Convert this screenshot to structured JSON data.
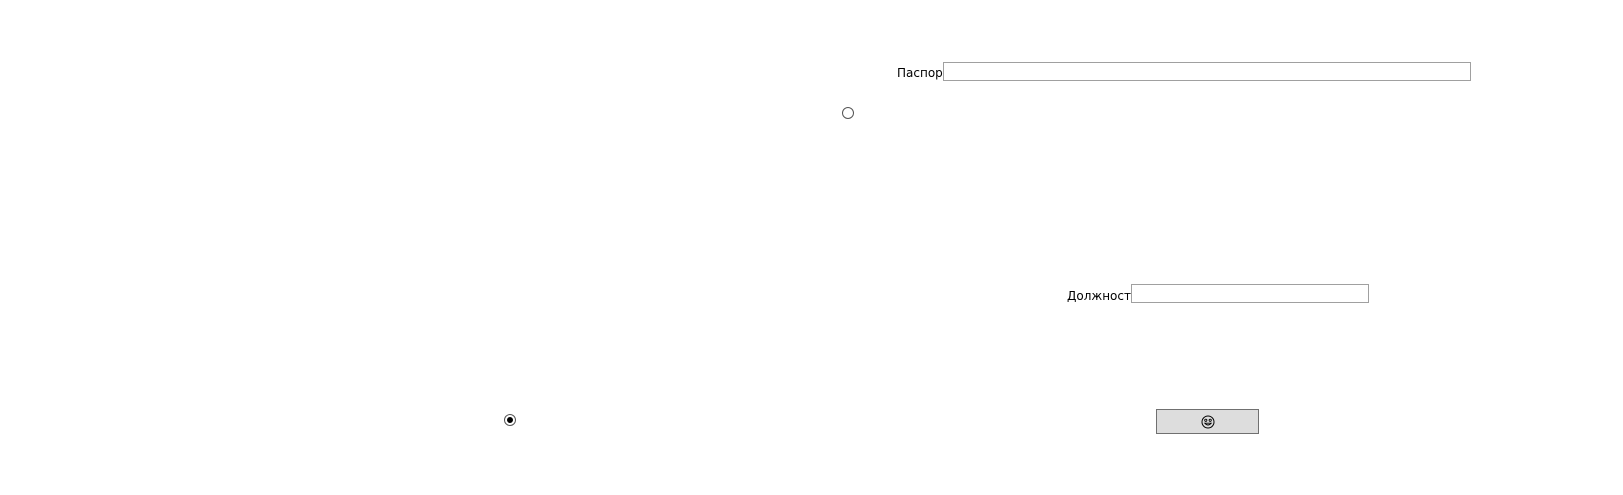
{
  "form": {
    "passport": {
      "label": "Паспорт",
      "value": "",
      "placeholder": ""
    },
    "position": {
      "label": "Должность",
      "value": "",
      "placeholder": ""
    },
    "radios": [
      {
        "checked": false
      },
      {
        "checked": true
      }
    ],
    "submit_button": {
      "icon": "smiley-icon"
    }
  }
}
